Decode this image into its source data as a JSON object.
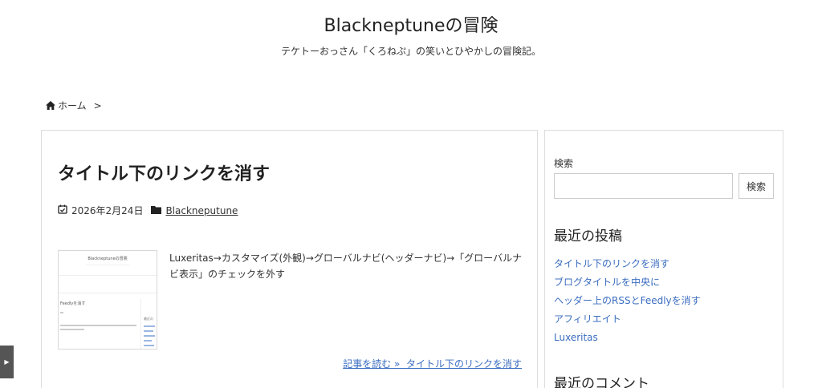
{
  "site": {
    "title": "Blackneptuneの冒険",
    "description": "テケトーおっさん「くろねぷ」の笑いとひやかしの冒険記。"
  },
  "breadcrumb": {
    "home_label": "ホーム",
    "separator": ">"
  },
  "post": {
    "title": "タイトル下のリンクを消す",
    "date": "2026年2月24日",
    "category": "Blackneputune",
    "excerpt": "Luxeritas→カスタマイズ(外観)→グローバルナビ(ヘッダーナビ)→「グローバルナビ表示」のチェックを外す",
    "read_more": "記事を読む »  タイトル下のリンクを消す",
    "thumbnail": {
      "site_title": "Blackneptuneの冒険",
      "heading": "Feedlyを消す",
      "side_label": "最近の"
    }
  },
  "sidebar": {
    "search_label": "検索",
    "search_value": "",
    "search_button": "検索",
    "recent_posts_title": "最近の投稿",
    "recent_posts": [
      "タイトル下のリンクを消す",
      "ブログタイトルを中央に",
      "ヘッダー上のRSSとFeedlyを消す",
      "アフィリエイト",
      "Luxeritas"
    ],
    "recent_comments_title": "最近のコメント"
  },
  "toggle": {
    "symbol": "▶"
  },
  "colors": {
    "link": "#3b6dc0",
    "border": "#dddddd"
  }
}
